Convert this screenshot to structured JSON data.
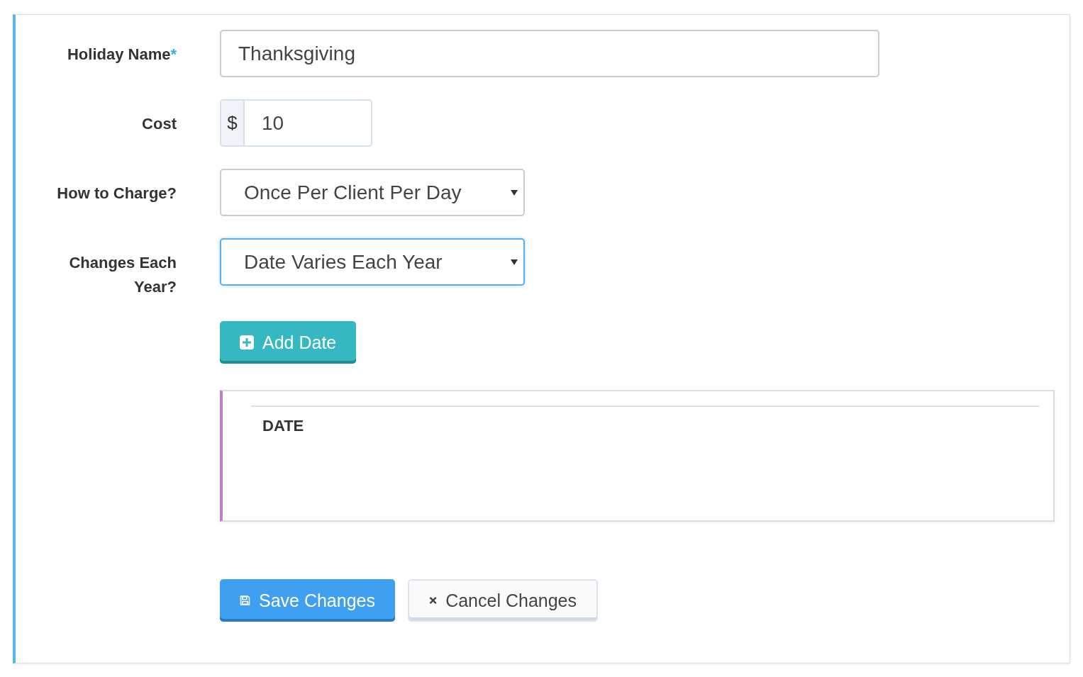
{
  "fields": [
    {
      "kind": "text",
      "label": "Holiday Name",
      "required_mark": "*",
      "value": "Thanksgiving",
      "focused": false
    },
    {
      "kind": "addon",
      "label": "Cost",
      "addon": "$",
      "value": "10",
      "focused": false
    },
    {
      "kind": "select",
      "label": "How to Charge?",
      "value": "Once Per Client Per Day",
      "focused": false
    },
    {
      "kind": "select",
      "label": "Changes Each Year?",
      "value": "Date Varies Each Year",
      "focused": true
    }
  ],
  "add_button": {
    "label": "Add Date"
  },
  "dates_table": {
    "columns": [
      "DATE"
    ]
  },
  "actions": [
    {
      "kind": "save",
      "label": "Save Changes"
    },
    {
      "kind": "cancel",
      "label": "Cancel Changes"
    }
  ]
}
